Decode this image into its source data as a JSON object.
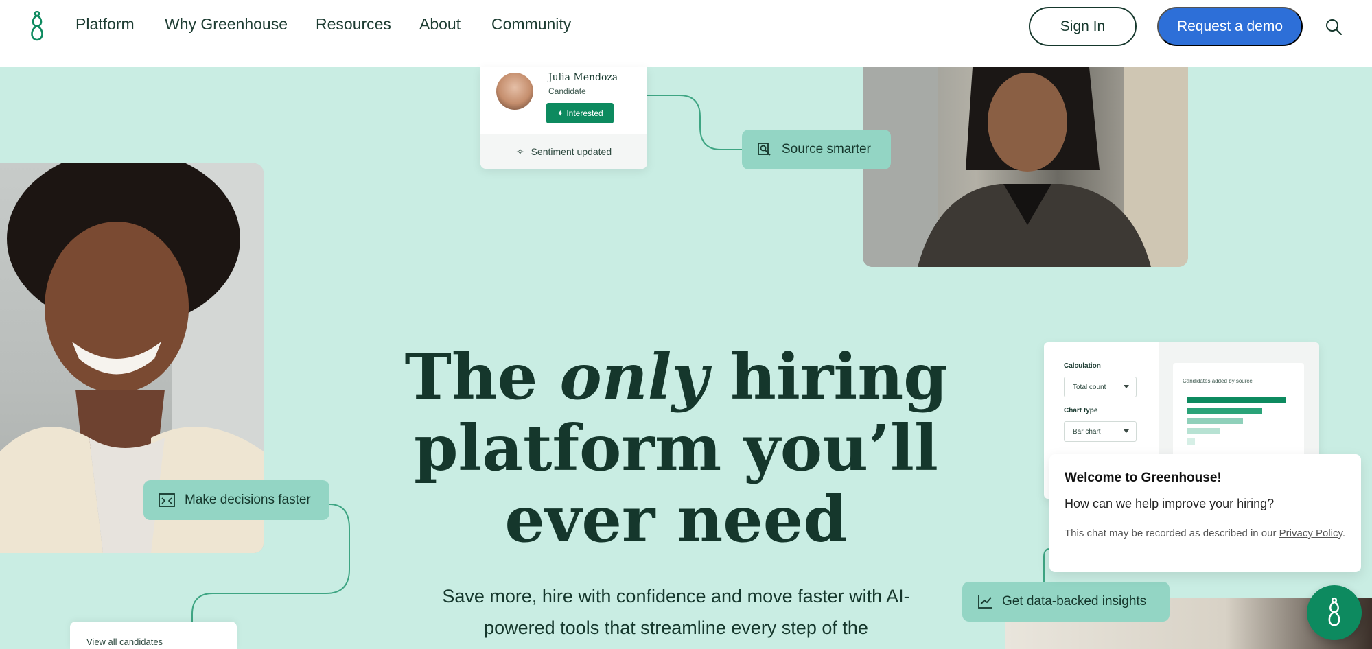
{
  "nav": {
    "links": [
      "Platform",
      "Why Greenhouse",
      "Resources",
      "About",
      "Community"
    ],
    "sign_in": "Sign In",
    "request_demo": "Request a demo"
  },
  "cards": {
    "candidate": {
      "name": "Julia Mendoza",
      "role": "Candidate",
      "badge": "Interested",
      "footer": "Sentiment updated"
    },
    "source_pill": "Source smarter",
    "decisions_pill": "Make decisions faster",
    "insights_pill": "Get data-backed insights",
    "report": {
      "calculation_label": "Calculation",
      "calculation_value": "Total count",
      "chart_type_label": "Chart type",
      "chart_type_value": "Bar chart",
      "chart_title": "Candidates added by source"
    },
    "view_all": "View all candidates"
  },
  "chat": {
    "title": "Welcome to Greenhouse!",
    "question": "How can we help improve your hiring?",
    "note": "This chat may be recorded as described in our ",
    "link": "Privacy Policy",
    "note_end": "."
  },
  "hero": {
    "title_pre": "The ",
    "title_em": "only",
    "title_post": " hiring platform you’ll ever need",
    "subtitle": "Save more, hire with confidence and move faster with AI-powered tools that streamline every step of the"
  },
  "colors": {
    "background": "#c9ede3",
    "brand_green": "#0d8a5f",
    "demo_blue": "#2d6fd8",
    "pill": "#93d5c4",
    "text_dark": "#15372c"
  },
  "icons": [
    "greenhouse-logo-icon",
    "search-icon",
    "sparkle-icon",
    "source-search-icon",
    "compare-icon",
    "chart-trend-icon",
    "chat-logo-icon"
  ]
}
